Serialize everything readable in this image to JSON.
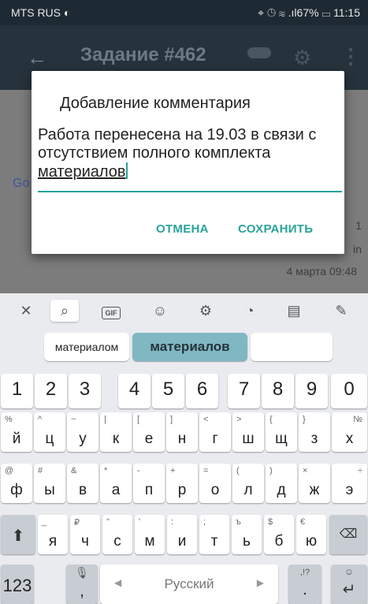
{
  "status_bar": {
    "carrier": "MTS RUS",
    "battery": "67%",
    "time": "11:15"
  },
  "app_bar": {
    "title": "Задание #462"
  },
  "background": {
    "link_fragment": "Go",
    "right_text_1": "1",
    "right_text_2": "in",
    "timestamp": "4 марта 09:48"
  },
  "dialog": {
    "title": "Добавление комментария",
    "text_plain": "Работа перенесена на 19.03 в связи с отсутствием полного комплекта ",
    "text_underlined": "материалов",
    "cancel_label": "ОТМЕНА",
    "save_label": "СОХРАНИТЬ"
  },
  "keyboard": {
    "suggestions": [
      "материалом",
      "материалов",
      ""
    ],
    "numbers": [
      "1",
      "2",
      "3",
      "4",
      "5",
      "6",
      "7",
      "8",
      "9",
      "0"
    ],
    "row1": [
      {
        "main": "й",
        "sub": "%"
      },
      {
        "main": "ц",
        "sub": "^"
      },
      {
        "main": "у",
        "sub": "~"
      },
      {
        "main": "к",
        "sub": "|"
      },
      {
        "main": "е",
        "sub": "["
      },
      {
        "main": "н",
        "sub": "]"
      },
      {
        "main": "г",
        "sub": "<"
      },
      {
        "main": "ш",
        "sub": ">"
      },
      {
        "main": "щ",
        "sub": "{"
      },
      {
        "main": "з",
        "sub": "}"
      },
      {
        "main": "х",
        "sub": "№"
      }
    ],
    "row2": [
      {
        "main": "ф",
        "sub": "@"
      },
      {
        "main": "ы",
        "sub": "#"
      },
      {
        "main": "в",
        "sub": "&"
      },
      {
        "main": "а",
        "sub": "*"
      },
      {
        "main": "п",
        "sub": "-"
      },
      {
        "main": "р",
        "sub": "+"
      },
      {
        "main": "о",
        "sub": "="
      },
      {
        "main": "л",
        "sub": "("
      },
      {
        "main": "д",
        "sub": ")"
      },
      {
        "main": "ж",
        "sub": "×"
      },
      {
        "main": "э",
        "sub": "÷"
      }
    ],
    "row3": [
      {
        "main": "я",
        "sub": "_"
      },
      {
        "main": "ч",
        "sub": "₽"
      },
      {
        "main": "с",
        "sub": "\""
      },
      {
        "main": "м",
        "sub": "'"
      },
      {
        "main": "и",
        "sub": ":"
      },
      {
        "main": "т",
        "sub": ";"
      },
      {
        "main": "ь",
        "sub": "ъ"
      },
      {
        "main": "б",
        "sub": "$"
      },
      {
        "main": "ю",
        "sub": "€"
      }
    ],
    "mode_key": "123",
    "comma_key": ",",
    "space_label": "Русский",
    "period_key": ".",
    "period_alt": ",!?"
  },
  "colors": {
    "accent": "#29a39a",
    "suggestion_selected": "#7fb7c3"
  }
}
